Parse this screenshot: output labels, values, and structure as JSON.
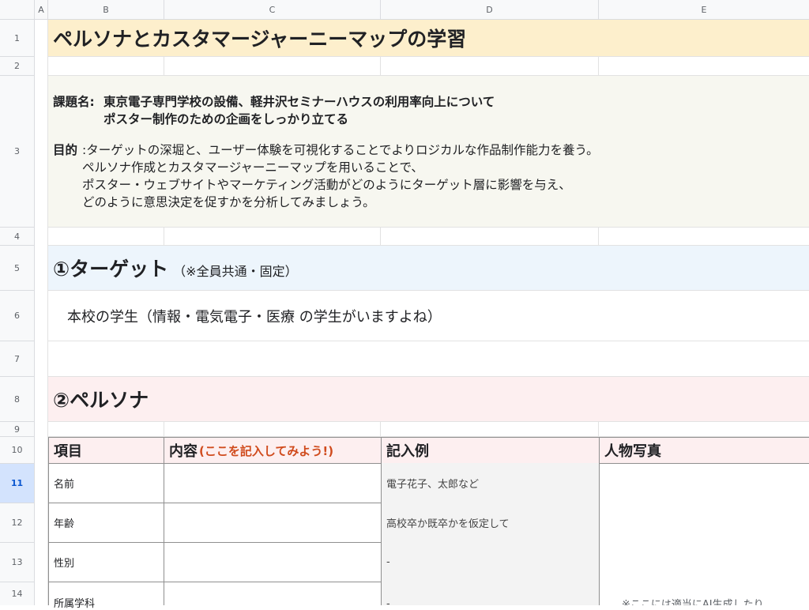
{
  "columns": [
    "A",
    "B",
    "C",
    "D",
    "E"
  ],
  "rows": [
    "1",
    "2",
    "3",
    "4",
    "5",
    "6",
    "7",
    "8",
    "9",
    "10",
    "11",
    "12",
    "13",
    "14"
  ],
  "title": "ペルソナとカスタマージャーニーマップの学習",
  "assignment": {
    "label": "課題名:",
    "line1": "東京電子専門学校の設備、軽井沢セミナーハウスの利用率向上について",
    "line2": "ポスター制作のための企画をしっかり立てる"
  },
  "purpose": {
    "label": "目的",
    "line1": ":ターゲットの深堀と、ユーザー体験を可視化することでよりロジカルな作品制作能力を養う。",
    "line2": "ペルソナ作成とカスタマージャーニーマップを用いることで、",
    "line3": "ポスター・ウェブサイトやマーケティング活動がどのようにターゲット層に影響を与え、",
    "line4": "どのように意思決定を促すかを分析してみましょう。"
  },
  "section1": {
    "heading": "①ターゲット",
    "note": "（※全員共通・固定）"
  },
  "target_text": "本校の学生（情報・電気電子・医療 の学生がいますよね）",
  "section2": {
    "heading": "②ペルソナ"
  },
  "table": {
    "headers": {
      "item": "項目",
      "content": "内容",
      "content_hint": "(ここを記入してみよう!)",
      "example": "記入例",
      "photo": "人物写真"
    },
    "rows": [
      {
        "item": "名前",
        "example": "電子花子、太郎など"
      },
      {
        "item": "年齢",
        "example": "高校卒か既卒かを仮定して"
      },
      {
        "item": "性別",
        "example": "-"
      },
      {
        "item": "所属学科",
        "example": "-"
      }
    ],
    "photo_note": "※ここには適当にAI生成したり"
  },
  "colors": {
    "title_bg": "#fdefcc",
    "assignment_bg": "#f7f7f0",
    "section1_bg": "#edf5fc",
    "section2_bg": "#fdeff0",
    "header_bg": "#fdeff0",
    "hint_red": "#d04b1d"
  }
}
